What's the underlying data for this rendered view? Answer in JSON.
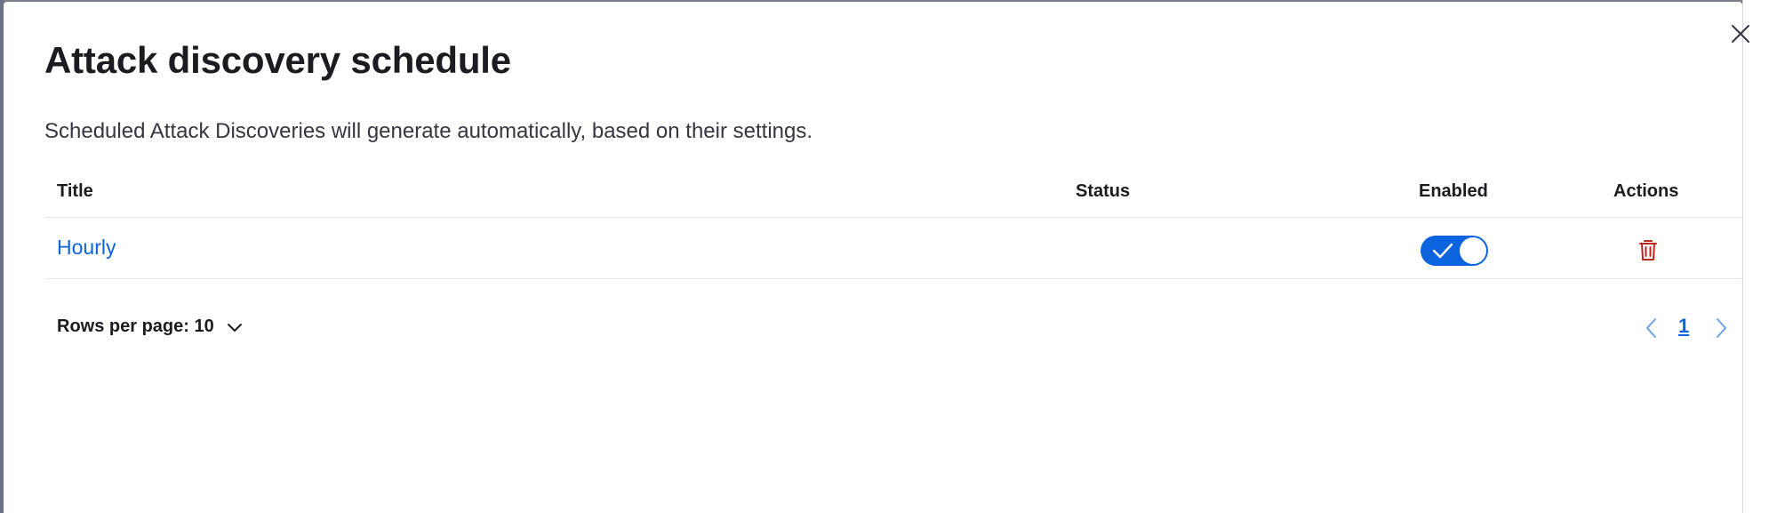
{
  "modal": {
    "title": "Attack discovery schedule",
    "description": "Scheduled Attack Discoveries will generate automatically, based on their settings."
  },
  "table": {
    "columns": [
      "Title",
      "Status",
      "Enabled",
      "Actions"
    ],
    "rows": [
      {
        "title": "Hourly",
        "status": "",
        "enabled": true
      }
    ]
  },
  "pagination": {
    "rows_per_page_label": "Rows per page: 10",
    "current_page": "1"
  },
  "icons": {
    "close": "close-icon",
    "check": "check-icon",
    "delete": "trash-icon",
    "chevron_down": "chevron-down-icon",
    "prev": "chevron-left-icon",
    "next": "chevron-right-icon"
  },
  "colors": {
    "accent": "#0b64dd",
    "danger": "#bd271e",
    "text": "#1a1c21"
  }
}
